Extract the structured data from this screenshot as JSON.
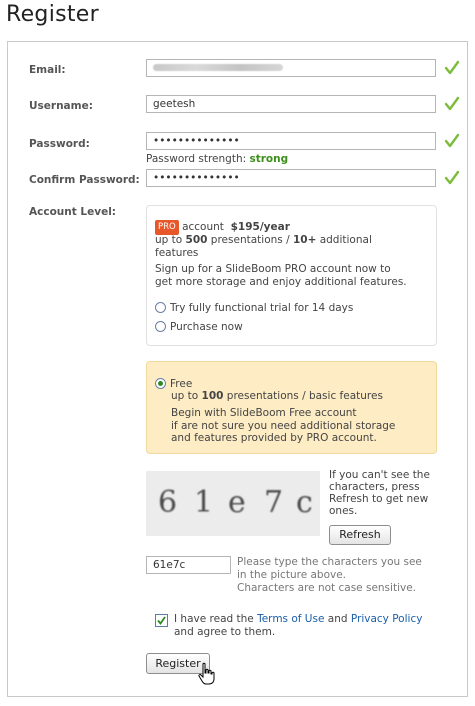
{
  "page": {
    "title": "Register"
  },
  "form": {
    "email": {
      "label": "Email:",
      "value": ""
    },
    "username": {
      "label": "Username:",
      "value": "geetesh"
    },
    "password": {
      "label": "Password:",
      "value": "••••••••••••••"
    },
    "password_strength": {
      "prefix": "Password strength: ",
      "value": "strong"
    },
    "confirm_password": {
      "label": "Confirm Password:",
      "value": "••••••••••••••"
    },
    "account_level_label": "Account Level:"
  },
  "pro": {
    "badge": "PRO",
    "account_word": "account",
    "price": "$195/year",
    "features_line1_a": "up to ",
    "features_line1_b": "500",
    "features_line1_c": " presentations / ",
    "features_line1_d": "10+",
    "features_line1_e": " additional",
    "features_line2": "features",
    "desc_line1": "Sign up for a SlideBoom PRO account now to",
    "desc_line2": "get more storage and enjoy additional features.",
    "option_trial": "Try fully functional trial for 14 days",
    "option_purchase": "Purchase now"
  },
  "free": {
    "label": "Free",
    "features_a": "up to ",
    "features_b": "100",
    "features_c": " presentations / basic features",
    "desc_line1": "Begin with SlideBoom Free account",
    "desc_line2": "if are not sure you need additional storage",
    "desc_line3": "and features provided by PRO account."
  },
  "captcha": {
    "chars": [
      "6",
      "1",
      "e",
      "7",
      "c"
    ],
    "help_line1": "If you can't see the",
    "help_line2": "characters, press",
    "help_line3": "Refresh to get new",
    "help_line4": "ones.",
    "refresh_label": "Refresh",
    "input_value": "61e7c",
    "hint_line1": "Please type the characters you see",
    "hint_line2": "in the picture above.",
    "hint_line3": "Characters are not case sensitive."
  },
  "agree": {
    "text_a": "I have read the ",
    "terms": "Terms of Use",
    "and": " and ",
    "privacy": "Privacy Policy",
    "text_b": "and agree to them."
  },
  "register_label": "Register",
  "colors": {
    "check": "#7dbb3c",
    "strong": "#3d8f1c",
    "pro_badge": "#e8572a",
    "free_bg": "#fdecc4",
    "link": "#1a5ea8"
  }
}
